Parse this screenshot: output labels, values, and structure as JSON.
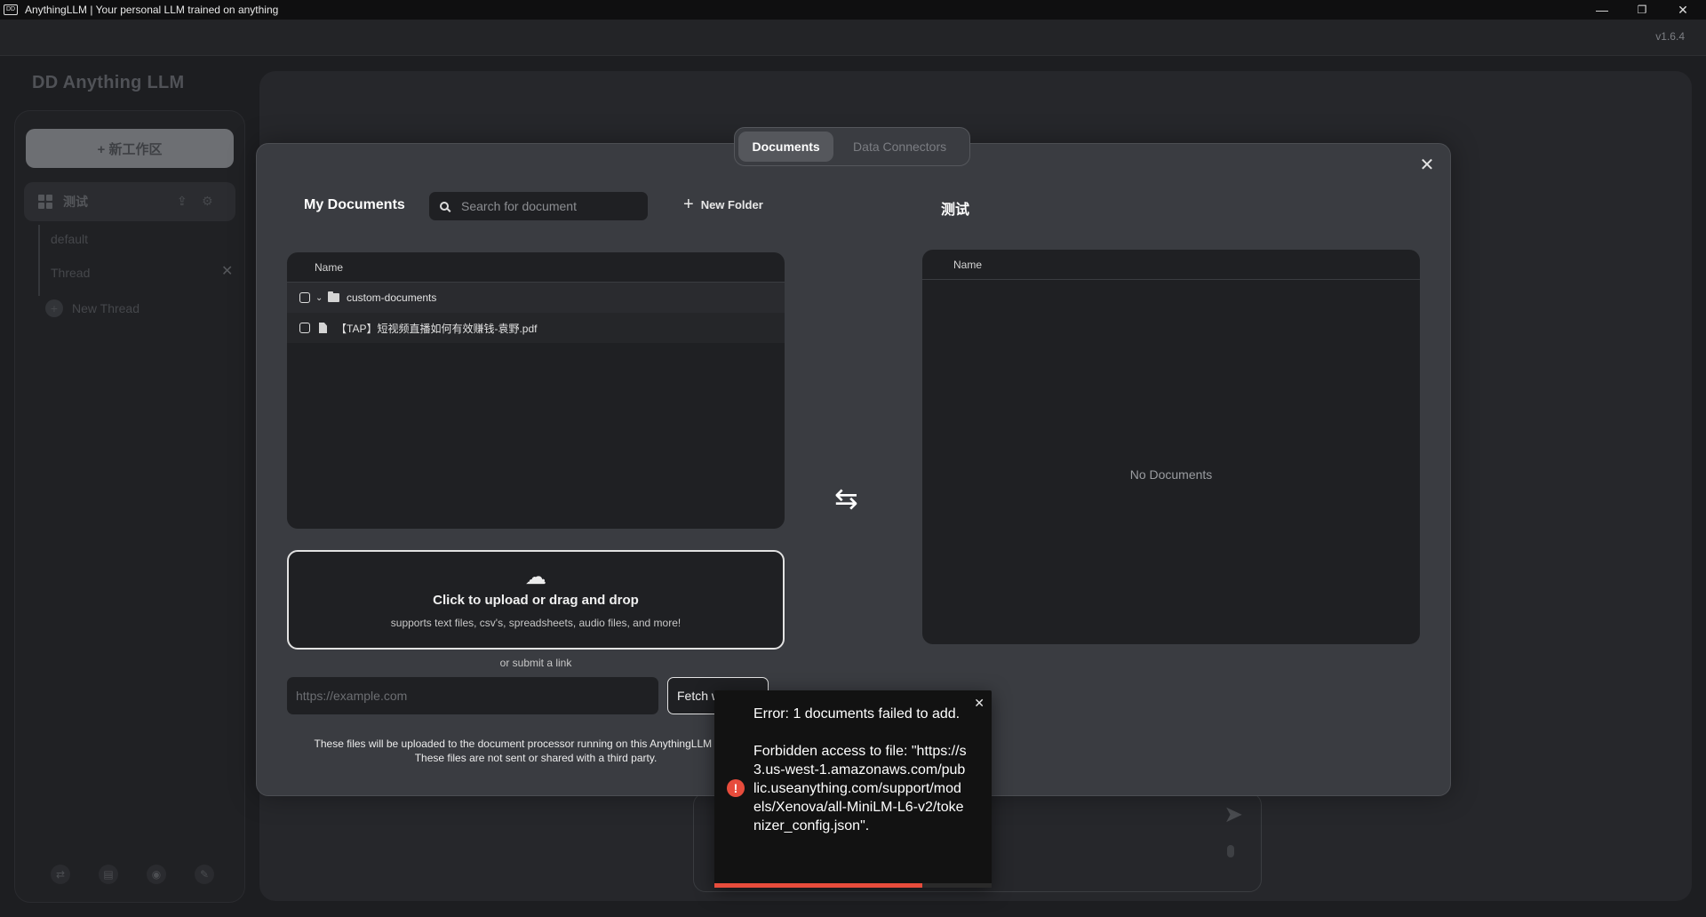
{
  "window": {
    "title": "AnythingLLM | Your personal LLM trained on anything",
    "logo": "DD",
    "version": "v1.6.4",
    "minimize": "—",
    "maximize": "❐",
    "close": "✕"
  },
  "sidebar": {
    "logo_text": "DD Anything LLM",
    "new_workspace_label": "+ 新工作区",
    "workspace": {
      "name": "测试",
      "upload_icon": "⇪",
      "gear_icon": "⚙"
    },
    "threads": [
      {
        "label": "default"
      },
      {
        "label": "Thread"
      }
    ],
    "thread_delete": "✕",
    "new_thread_icon": "+",
    "new_thread_label": "New Thread",
    "footer_icons": [
      "⇄",
      "▤",
      "◉",
      "✎"
    ]
  },
  "modal": {
    "tabs": [
      {
        "label": "Documents",
        "active": true
      },
      {
        "label": "Data Connectors",
        "active": false
      }
    ],
    "close_icon": "✕",
    "my_documents_title": "My Documents",
    "search_placeholder": "Search for document",
    "new_folder_icon": "+",
    "new_folder_label": "New Folder",
    "workspace_title": "测试",
    "left_list": {
      "header": "Name",
      "folder": {
        "chevron": "⌄",
        "name": "custom-documents"
      },
      "file": {
        "name": "【TAP】短视频直播如何有效赚钱-袁野.pdf"
      }
    },
    "swap_icon": "⇆",
    "right_list": {
      "header": "Name",
      "empty_text": "No Documents"
    },
    "upload": {
      "cloud_icon": "☁",
      "title": "Click to upload or drag and drop",
      "subtitle": "supports text files, csv's, spreadsheets, audio files, and more!"
    },
    "or_submit_link": "or submit a link",
    "link_placeholder": "https://example.com",
    "fetch_label": "Fetch website",
    "privacy_line1": "These files will be uploaded to the document processor running on this AnythingLLM instance.",
    "privacy_line2": "These files are not sent or shared with a third party."
  },
  "prompt": {
    "send_icon": "➤"
  },
  "toast": {
    "close_icon": "✕",
    "error_icon": "!",
    "message": "Error: 1 documents failed to add.\n\nForbidden access to file: \"https://s3.us-west-1.amazonaws.com/public.useanything.com/support/models/Xenova/all-MiniLM-L6-v2/tokenizer_config.json\".",
    "progress": 0.75,
    "progress_color": "#e74c3c"
  },
  "colors": {
    "background": "#1d1e21",
    "modal": "#3a3c41",
    "panel": "#1f2023",
    "accent_error": "#e74c3c"
  }
}
